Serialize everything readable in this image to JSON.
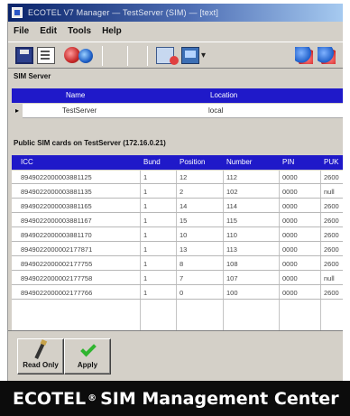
{
  "window": {
    "title": "ECOTEL V7 Manager — TestServer (SIM) — [text]"
  },
  "menu": [
    "File",
    "Edit",
    "Tools",
    "Help"
  ],
  "toolbar_icons": [
    "save-icon",
    "page-icon",
    "disk-red-icon",
    "disk-blue-icon",
    "document-icon",
    "monitor-icon",
    "dropdown-arrow-icon",
    "users-icon",
    "users-icon"
  ],
  "sim_server": {
    "label": "SIM Server",
    "columns": [
      "Name",
      "Location"
    ],
    "row": {
      "marker": "▸",
      "name": "TestServer",
      "location": "local"
    }
  },
  "cards": {
    "label": "Public SIM cards on TestServer (172.16.0.21)",
    "columns": [
      "ICC",
      "Bund",
      "Position",
      "Number",
      "PIN",
      "PUK"
    ],
    "rows": [
      [
        "8949022000003881125",
        "1",
        "12",
        "112",
        "0000",
        "2600"
      ],
      [
        "8949022000003881135",
        "1",
        "2",
        "102",
        "0000",
        "null"
      ],
      [
        "8949022000003881165",
        "1",
        "14",
        "114",
        "0000",
        "2600"
      ],
      [
        "8949022000003881167",
        "1",
        "15",
        "115",
        "0000",
        "2600"
      ],
      [
        "8949022000003881170",
        "1",
        "10",
        "110",
        "0000",
        "2600"
      ],
      [
        "8949022000002177871",
        "1",
        "13",
        "113",
        "0000",
        "2600"
      ],
      [
        "8949022000002177755",
        "1",
        "8",
        "108",
        "0000",
        "2600"
      ],
      [
        "8949022000002177758",
        "1",
        "7",
        "107",
        "0000",
        "null"
      ],
      [
        "8949022000002177766",
        "1",
        "0",
        "100",
        "0000",
        "2600"
      ]
    ]
  },
  "actions": {
    "read_label": "Read Only",
    "apply_label": "Apply"
  },
  "banner": {
    "brand": "ECOTEL",
    "reg": "®",
    "product": "SIM Management Center"
  }
}
